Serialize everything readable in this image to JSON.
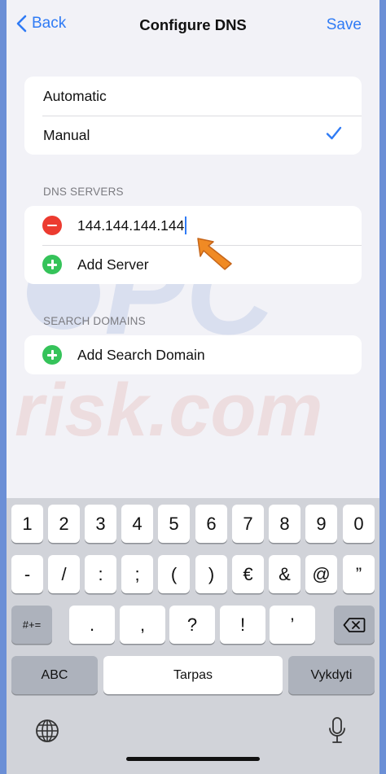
{
  "nav": {
    "back_label": "Back",
    "title": "Configure DNS",
    "save_label": "Save"
  },
  "mode": {
    "options": [
      "Automatic",
      "Manual"
    ],
    "selected": "Manual"
  },
  "dns_servers": {
    "header": "DNS SERVERS",
    "entries": [
      "144.144.144.144"
    ],
    "add_label": "Add Server"
  },
  "search_domains": {
    "header": "SEARCH DOMAINS",
    "add_label": "Add Search Domain"
  },
  "watermark": {
    "text1": "PC",
    "text2": "risk.com"
  },
  "keyboard": {
    "row1": [
      "1",
      "2",
      "3",
      "4",
      "5",
      "6",
      "7",
      "8",
      "9",
      "0"
    ],
    "row2": [
      "-",
      "/",
      ":",
      ";",
      "(",
      ")",
      "€",
      "&",
      "@",
      "”"
    ],
    "row3_left": "#+=",
    "row3": [
      ".",
      ",",
      "?",
      "!",
      "’"
    ],
    "abc": "ABC",
    "space": "Tarpas",
    "return": "Vykdyti"
  },
  "colors": {
    "accent": "#2f7bf5",
    "delete": "#ec3b30",
    "add": "#35c35a",
    "arrow": "#f08a24"
  }
}
